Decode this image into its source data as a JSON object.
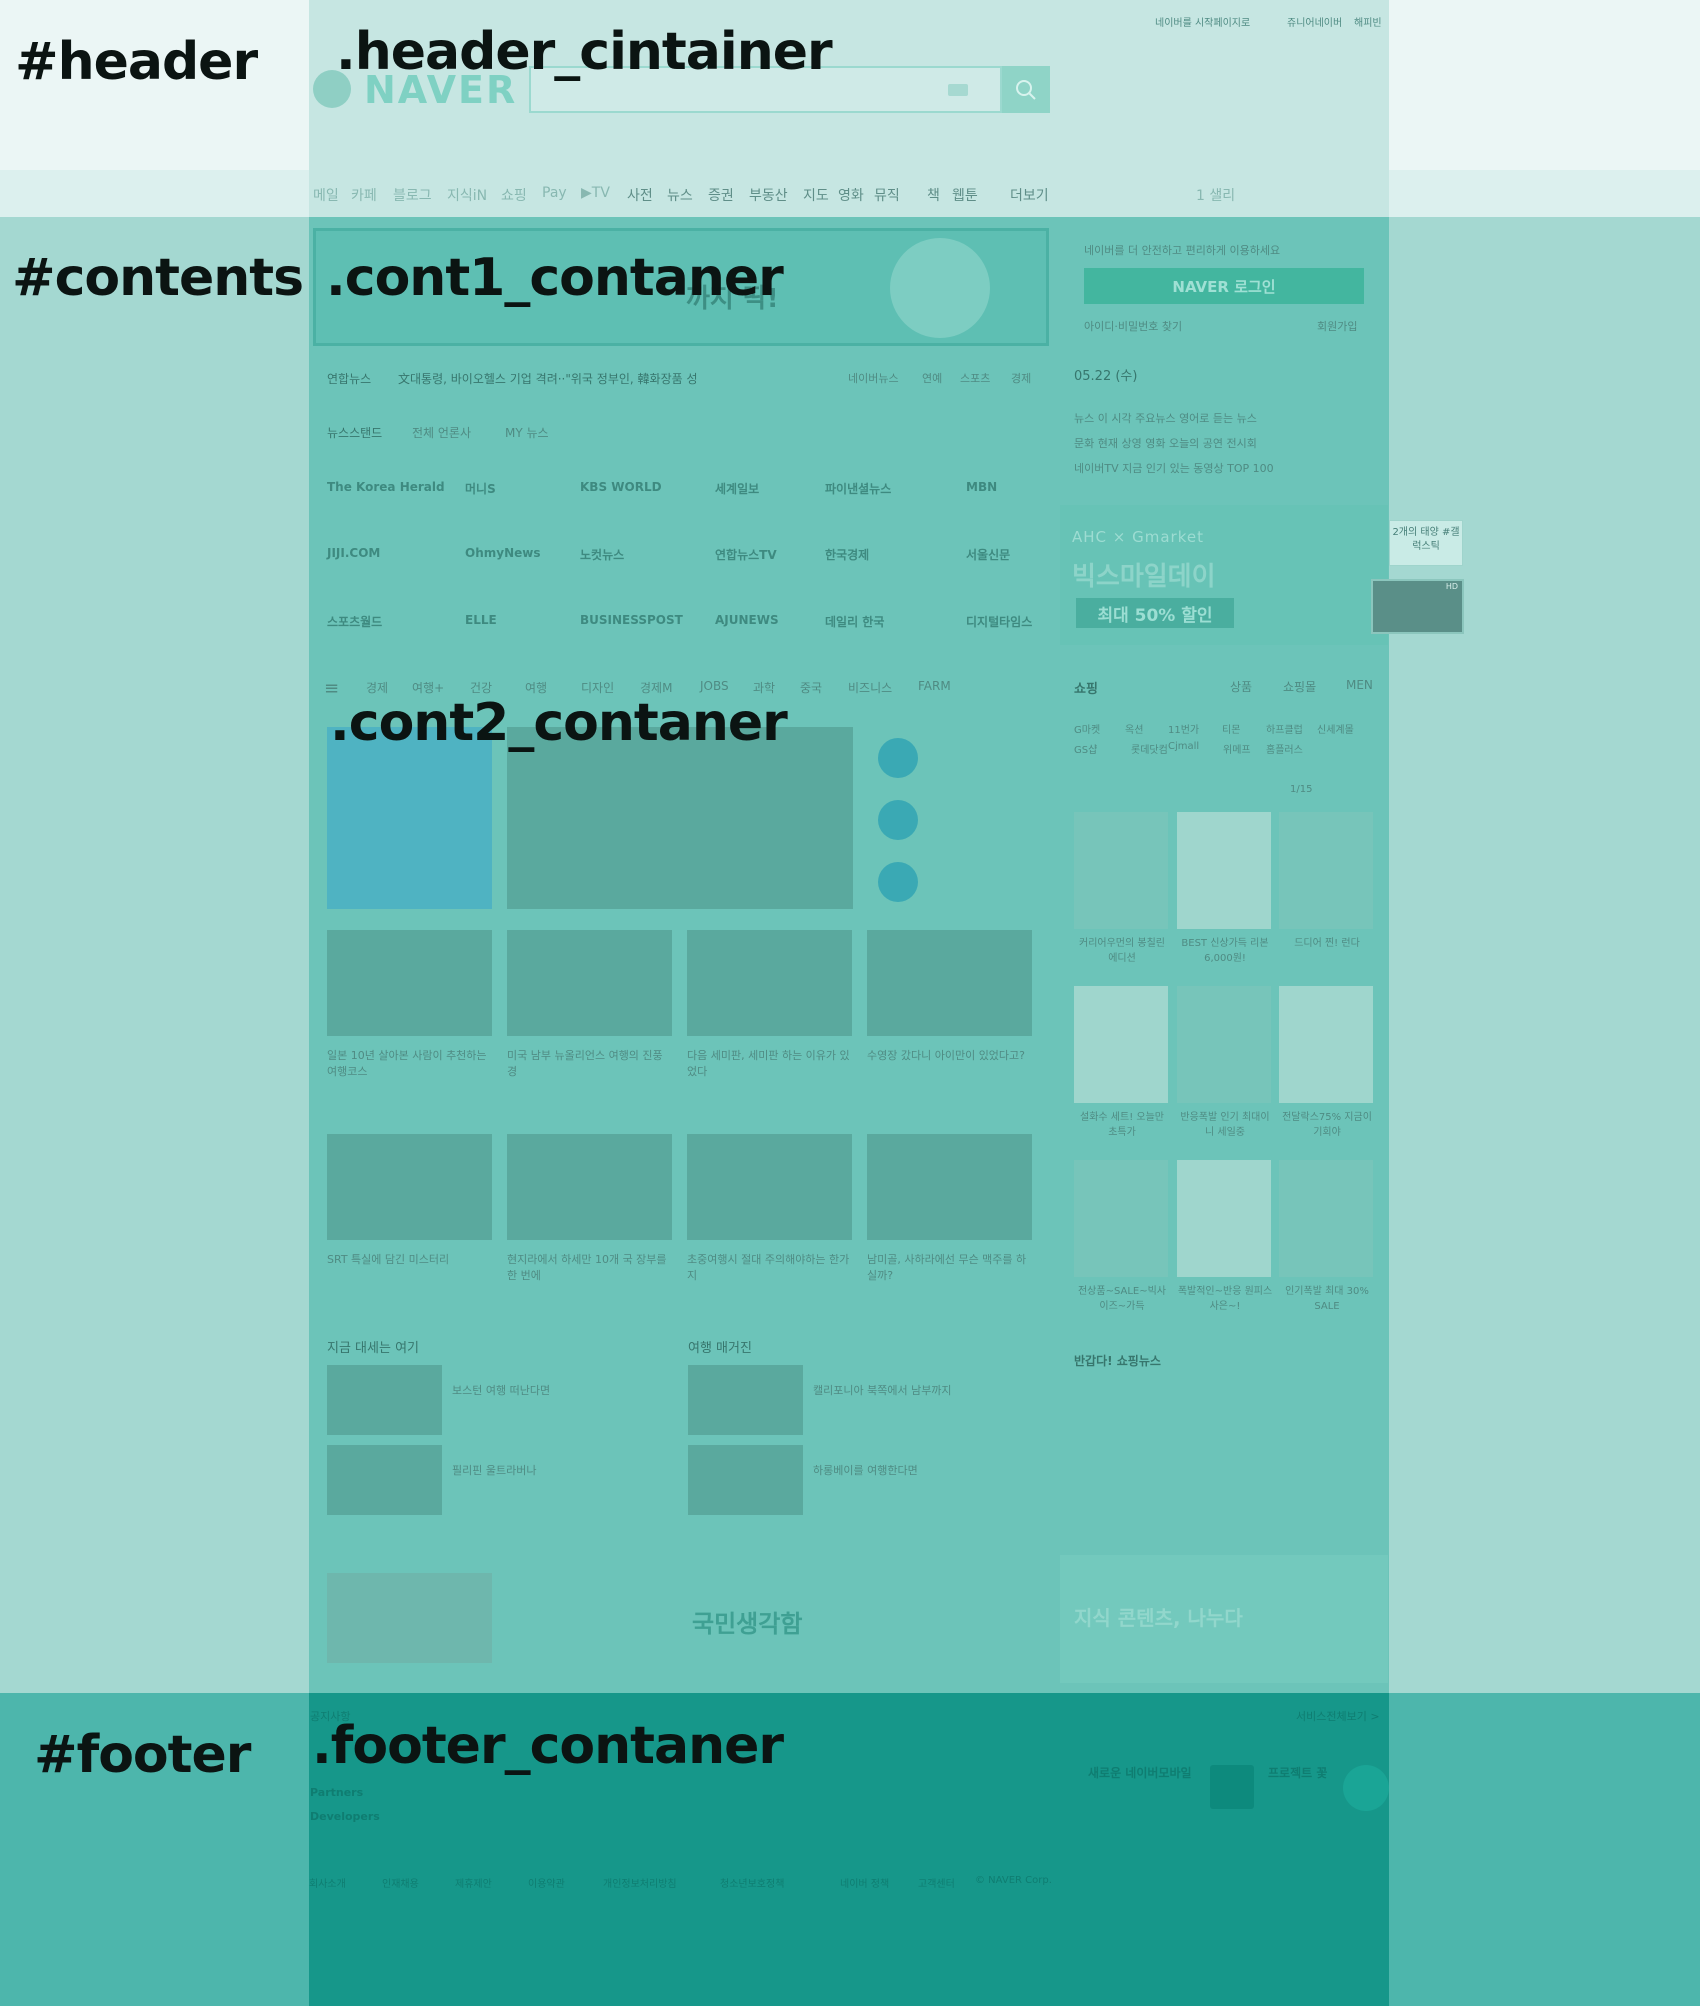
{
  "labels": {
    "header": "#header",
    "header_container": ".header_cintainer",
    "contents": "#contents",
    "cont1": ".cont1_contaner",
    "cont2": ".cont2_contaner",
    "footer": "#footer",
    "footer_container": ".footer_contaner"
  },
  "page": {
    "logo": "NAVER",
    "top_links": [
      "네이버를 시작페이지로",
      "쥬니어네이버",
      "해피빈"
    ],
    "nav": [
      "메일",
      "카페",
      "블로그",
      "지식iN",
      "쇼핑",
      "Pay",
      "▶TV",
      "사전",
      "뉴스",
      "증권",
      "부동산",
      "지도",
      "영화",
      "뮤직",
      "책",
      "웹툰",
      "더보기"
    ],
    "weather": "1  샐리",
    "login_prompt": "네이버를 더 안전하고 편리하게 이용하세요",
    "login_button": "NAVER 로그인",
    "login_links": [
      "아이디·비밀번호 찾기",
      "회원가입"
    ],
    "banner_text": "까지 딱!",
    "news_ticker": [
      "연합뉴스",
      "文대통령, 바이오헬스 기업 격려··\"위국 정부인, 韓화장품 성"
    ],
    "news_tabs": [
      "네이버뉴스",
      "연예",
      "스포츠",
      "경제"
    ],
    "newsstand": [
      "뉴스스탠드",
      "전체 언론사",
      "MY 뉴스"
    ],
    "date": "05.22 (수)",
    "press": [
      "The Korea Herald",
      "머니S",
      "KBS WORLD",
      "세계일보",
      "파이낸셜뉴스",
      "MBN",
      "JIJI.COM",
      "OhmyNews",
      "노컷뉴스",
      "연합뉴스TV",
      "한국경제",
      "서울신문",
      "스포츠월드",
      "ELLE",
      "BUSINESSPOST",
      "AJUNEWS",
      "데일리 한국",
      "디지털타임스"
    ],
    "side_links": [
      "뉴스  이 시각 주요뉴스   영어로 듣는 뉴스",
      "문화  현재 상영 영화   오늘의 공연   전시회",
      "네이버TV  지금 인기 있는 동영상   TOP 100"
    ],
    "ad_brand": "AHC × Gmarket",
    "ad_title": "빅스마일데이",
    "ad_sale": "최대 50% 할인",
    "float_text": "2개의 태양 #갤럭스틱",
    "float_badge": "HD",
    "topic_tabs": [
      "경제",
      "여행+",
      "건강",
      "여행",
      "디자인",
      "경제M",
      "JOBS",
      "과학",
      "중국",
      "비즈니스",
      "FARM"
    ],
    "shopping": "쇼핑",
    "shopping_tabs": [
      "상품",
      "쇼핑몰",
      "MEN"
    ],
    "shopping_links": [
      "G마켓",
      "옥션",
      "11번가",
      "티몬",
      "하프클럽",
      "신세계몰",
      "GS샵",
      "롯데닷컴",
      "Cjmall",
      "위메프",
      "홈플러스"
    ],
    "shopping_page": "1/15",
    "travel_items": [
      "일본 10년 살아본 사람이 추천하는 여행코스",
      "미국 남부 뉴올리언스 여행의 진풍경",
      "다음 세미판, 세미판 하는 이유가 있었다",
      "수영장 갔다니 아이만이 있었다고?",
      "SRT 특실에 담긴 미스터리",
      "현지라에서 하세만 10개 국 장부를 한 번에",
      "초중여행시 절대 주의해야하는 한가지",
      "남미골, 사하라에선 무슨 맥주를 하실까?"
    ],
    "section_titles": [
      "지금 대세는 여기",
      "여행 매거진"
    ],
    "small_items": [
      "보스턴 여행 떠난다면",
      "필리핀 울트라버나",
      "캘리포니아 북쪽에서 남부까지",
      "하롱베이를 여행한다면"
    ],
    "product_captions": [
      "커리어우먼의 봉칠린 에디션",
      "BEST 신상가득 리본 6,000원!",
      "드디어 찐! 런다",
      "설화수 세트! 오늘만 초특가",
      "반응폭발 인기 최대이니 세일중",
      "전달락스75% 지금이기회야",
      "전상품~SALE~빅사이즈~가득",
      "폭발적인~반응 원피스 사은~!",
      "인기폭발 최대 30% SALE"
    ],
    "shopping_news_title": "반갑다! 쇼핑뉴스",
    "book_title": "국민생각함",
    "ad2_title": "지식 콘텐츠, 나누다",
    "footer_notice": "공지사항",
    "footer_service": "서비스전체보기 >",
    "footer_rows": [
      "Creators",
      "Partners",
      "Developers"
    ],
    "footer_links": [
      "회사소개",
      "인재채용",
      "제휴제안",
      "이용약관",
      "개인정보처리방침",
      "청소년보호정책",
      "네이버 정책",
      "고객센터",
      "© NAVER Corp."
    ],
    "footer_promo": [
      "새로운 네이버모바일",
      "프로젝트 꽃"
    ]
  }
}
